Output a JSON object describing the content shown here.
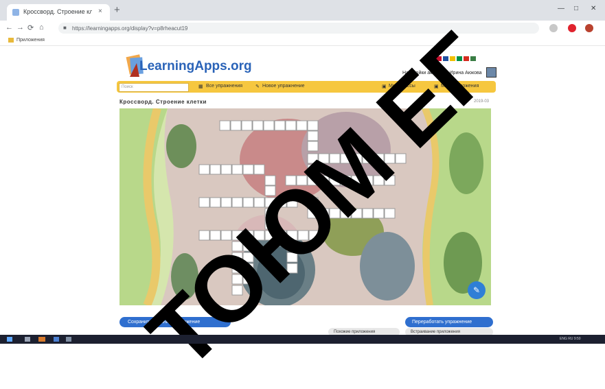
{
  "browser": {
    "tab_title": "Кроссворд. Строение клетки",
    "tab_close": "×",
    "new_tab": "+",
    "window_controls": [
      "—",
      "□",
      "✕"
    ],
    "url": "https://learningapps.org/display?v=p8rheacut19",
    "bookmark_label": "Приложения"
  },
  "site": {
    "logo_text": "LearningApps.org",
    "user_line": "Настройки аккаунта: Ирина Аюкова",
    "search_placeholder": "Поиск",
    "nav": {
      "all_exercises": "Все упражнения",
      "new_exercise": "Новое упражнение",
      "my_classes": "Мои классы",
      "my_apps": "Мои приложения"
    },
    "page_title": "Кроссворд. Строение клетки",
    "page_date": "2019-03",
    "buttons": {
      "save_app": "Сохранить задание приложение",
      "rework": "Переработать упражнение",
      "similar": "Похожие приложения",
      "embed": "Встраивание приложения"
    }
  },
  "taskbar": {
    "tray_text": "ENG  RU  9:50"
  },
  "watermark_text": "ТОЮМ ЕГ",
  "colors": {
    "accent_blue": "#2f6fcf",
    "appbar_yellow": "#f6c73f",
    "logo_blue": "#2a63b8"
  },
  "icons": [
    "favicon-icon",
    "back-icon",
    "forward-icon",
    "reload-icon",
    "home-icon",
    "lock-icon",
    "pinterest-icon",
    "profile-icon",
    "edit-icon",
    "windows-start-icon"
  ]
}
